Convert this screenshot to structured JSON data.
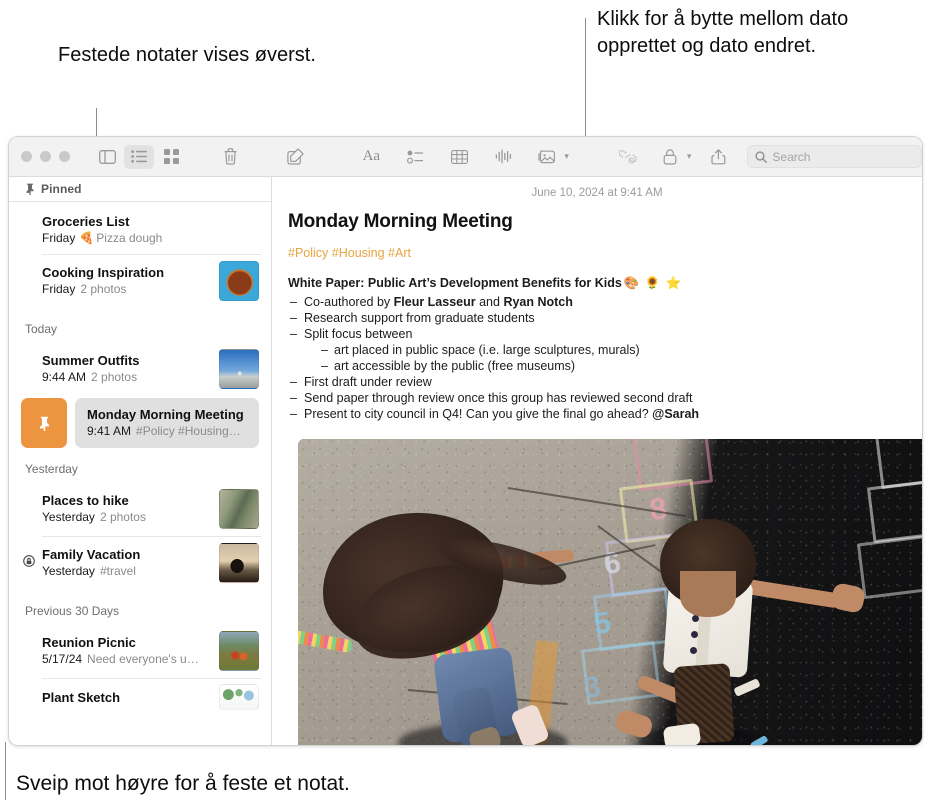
{
  "callouts": {
    "pinned": "Festede notater vises øverst.",
    "date": "Klikk for å bytte mellom dato opprettet og dato endret.",
    "swipe": "Sveip mot høyre for å feste et notat."
  },
  "toolbar": {
    "icons": {
      "sidebar": "sidebar-icon",
      "list_view": "list-view-icon",
      "gallery_view": "gallery-view-icon",
      "delete": "trash-icon",
      "compose": "compose-icon",
      "format": "format-Aa-icon",
      "checklist": "checklist-icon",
      "table": "table-icon",
      "audio": "audio-waveform-icon",
      "media": "media-icon",
      "link": "link-icon",
      "lock": "lock-icon",
      "share": "share-icon"
    },
    "format_label": "Aa"
  },
  "search": {
    "placeholder": "Search",
    "value": ""
  },
  "sidebar": {
    "pinned_header": "Pinned",
    "groups": [
      {
        "label": "",
        "notes": [
          {
            "title": "Groceries List",
            "when": "Friday",
            "emoji": "🍕",
            "preview": "Pizza dough",
            "thumb": "none"
          },
          {
            "title": "Cooking Inspiration",
            "when": "Friday",
            "emoji": "",
            "preview": "2 photos",
            "thumb": "pizza"
          }
        ]
      },
      {
        "label": "Today",
        "notes": [
          {
            "title": "Summer Outfits",
            "when": "9:44 AM",
            "emoji": "",
            "preview": "2 photos",
            "thumb": "beach"
          }
        ]
      },
      {
        "label": "Yesterday",
        "notes": [
          {
            "title": "Places to hike",
            "when": "Yesterday",
            "emoji": "",
            "preview": "2 photos",
            "thumb": "river"
          },
          {
            "title": "Family Vacation",
            "when": "Yesterday",
            "emoji": "",
            "preview": "#travel",
            "thumb": "sunset",
            "locked": true
          }
        ]
      },
      {
        "label": "Previous 30 Days",
        "notes": [
          {
            "title": "Reunion Picnic",
            "when": "5/17/24",
            "emoji": "",
            "preview": "Need everyone's u…",
            "thumb": "picnic"
          },
          {
            "title": "Plant Sketch",
            "when": "",
            "emoji": "",
            "preview": "",
            "thumb": "plants"
          }
        ]
      }
    ],
    "selected_note": {
      "title": "Monday Morning Meeting",
      "when": "9:41 AM",
      "preview": "#Policy #Housing…",
      "pin_action_icon": "pin-icon",
      "pin_action_color": "#ed9440"
    }
  },
  "detail": {
    "date": "June 10, 2024 at 9:41 AM",
    "title": "Monday Morning Meeting",
    "tags": "#Policy #Housing #Art",
    "tags_color": "#e8a33d",
    "heading_text": "White Paper: Public Art’s Development Benefits for Kids",
    "heading_emoji": "🎨 🌻 ⭐",
    "bullets": [
      {
        "parts": [
          {
            "t": "Co-authored by ",
            "b": false
          },
          {
            "t": "Fleur Lasseur",
            "b": true
          },
          {
            "t": " and ",
            "b": false
          },
          {
            "t": "Ryan Notch",
            "b": true
          }
        ]
      },
      {
        "parts": [
          {
            "t": "Research support from graduate students",
            "b": false
          }
        ]
      },
      {
        "parts": [
          {
            "t": "Split focus between",
            "b": false
          }
        ],
        "children": [
          {
            "parts": [
              {
                "t": "art placed in public space (i.e. large sculptures, murals)",
                "b": false
              }
            ]
          },
          {
            "parts": [
              {
                "t": "art accessible by the public (free museums)",
                "b": false
              }
            ]
          }
        ]
      },
      {
        "parts": [
          {
            "t": "First draft under review",
            "b": false
          }
        ]
      },
      {
        "parts": [
          {
            "t": "Send paper through review once this group has reviewed second draft",
            "b": false
          }
        ]
      },
      {
        "parts": [
          {
            "t": "Present to city council in Q4! Can you give the final go ahead? ",
            "b": false
          },
          {
            "t": "@Sarah",
            "b": true
          }
        ]
      }
    ],
    "photo_alt": "Two children playing hopscotch on a chalk-drawn asphalt playground"
  }
}
